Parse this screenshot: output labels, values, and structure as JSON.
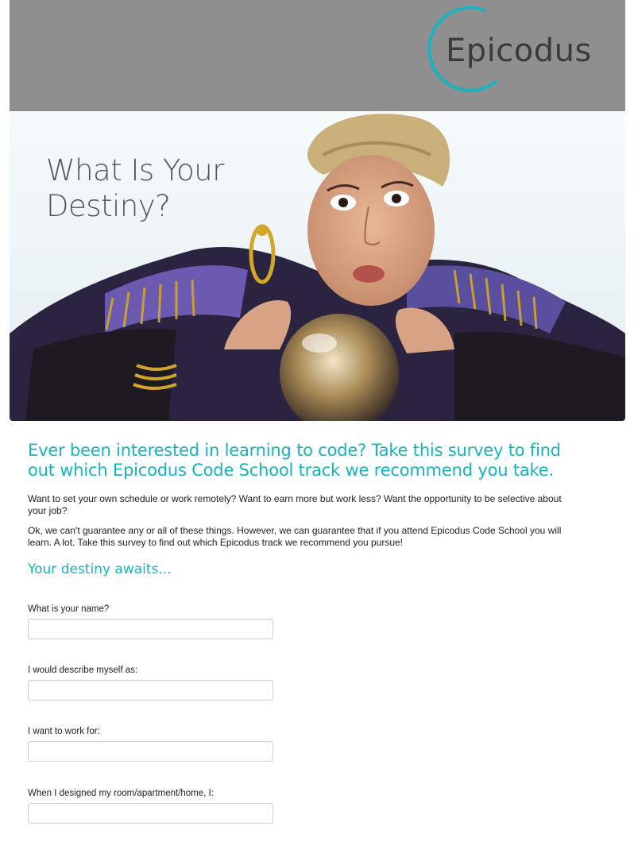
{
  "header": {
    "logo_text": "Epicodus",
    "accent_color": "#17b3c1"
  },
  "hero": {
    "title_line1": "What Is Your",
    "title_line2": "Destiny?"
  },
  "intro": {
    "lead": "Ever been interested in learning to code? Take this survey to find out which Epicodus Code School track we recommend you take.",
    "paragraph1": "Want to set your own schedule or work remotely? Want to earn more but work less? Want the opportunity to be selective about your job?",
    "paragraph2": "Ok, we can't guarantee any or all of these things. However, we can guarantee that if you attend Epicodus Code School you will learn. A lot. Take this survey to find out which Epicodus track we recommend you pursue!",
    "subhead": "Your destiny awaits..."
  },
  "form": {
    "fields": [
      {
        "label": "What is your name?",
        "value": "",
        "placeholder": ""
      },
      {
        "label": "I would describe myself as:",
        "value": "",
        "placeholder": ""
      },
      {
        "label": "I want to work for:",
        "value": "",
        "placeholder": ""
      },
      {
        "label": "When I designed my room/apartment/home, I:",
        "value": "",
        "placeholder": ""
      }
    ]
  }
}
